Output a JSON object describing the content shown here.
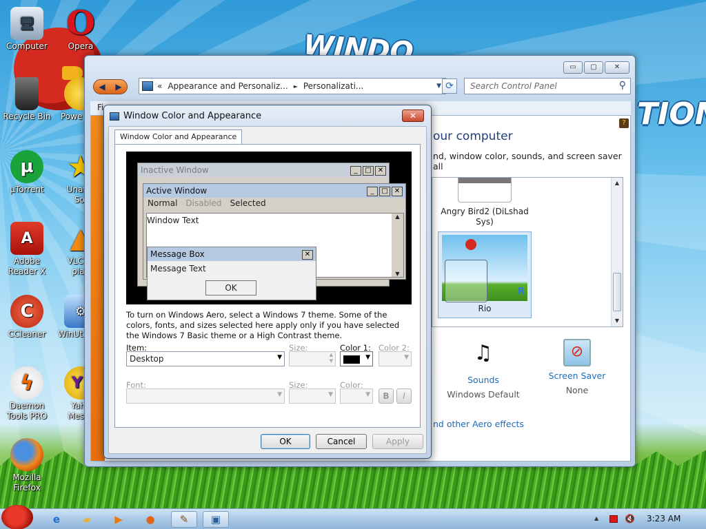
{
  "desktop": {
    "wallpaper_text_1": "WINDO",
    "wallpaper_text_2": "TION",
    "icons": [
      {
        "label": "Computer"
      },
      {
        "label": "Opera"
      },
      {
        "label": "Recycle Bin"
      },
      {
        "label": "Powe"
      },
      {
        "label": "µTorrent"
      },
      {
        "label": "Unatte\nSol"
      },
      {
        "label": "Adobe\nReader X"
      },
      {
        "label": "VLC m\nplay"
      },
      {
        "label": "CCleaner"
      },
      {
        "label": "WinUti"
      },
      {
        "label": "Daemon\nTools PRO"
      },
      {
        "label": "Yaho\nMesse"
      },
      {
        "label": "Mozilla\nFirefox"
      }
    ]
  },
  "control_panel": {
    "breadcrumb_sep": "«",
    "breadcrumb_1": "Appearance and Personaliz...",
    "breadcrumb_arrow": "►",
    "breadcrumb_2": "Personalizati...",
    "search_placeholder": "Search Control Panel",
    "menu_first": "Fi",
    "heading_fragment": "our computer",
    "subtext_fragment": "nd, window color, sounds, and screen saver all",
    "themes": [
      {
        "name": "Angry Bird2 (DiLshad Sys)"
      },
      {
        "name": "Rio"
      }
    ],
    "sounds_label": "Sounds",
    "sounds_value": "Windows Default",
    "screensaver_label": "Screen Saver",
    "screensaver_value": "None",
    "aero_link": "nd other Aero effects",
    "window_buttons": [
      "▭",
      "▢",
      "✕"
    ]
  },
  "dialog": {
    "title": "Window Color and Appearance",
    "close": "✕",
    "tab": "Window Color and Appearance",
    "preview": {
      "inactive_title": "Inactive Window",
      "active_title": "Active Window",
      "menu_normal": "Normal",
      "menu_disabled": "Disabled",
      "menu_selected": "Selected",
      "window_text": "Window Text",
      "msgbox_title": "Message Box",
      "msgbox_text": "Message Text",
      "msgbox_ok": "OK"
    },
    "description": "To turn on Windows Aero, select a Windows 7 theme.  Some of the colors, fonts, and sizes selected here apply only if you have selected the Windows 7 Basic theme or a High Contrast theme.",
    "item_label": "Item:",
    "item_value": "Desktop",
    "size_label": "Size:",
    "color1_label": "Color 1:",
    "color2_label": "Color 2:",
    "font_label": "Font:",
    "font_size_label": "Size:",
    "font_color_label": "Color:",
    "bold_label": "B",
    "italic_label": "I",
    "ok": "OK",
    "cancel": "Cancel",
    "apply": "Apply",
    "color1_value": "#000000"
  },
  "taskbar": {
    "clock": "3:23 AM",
    "tray_arrow": "▲"
  },
  "colors": {
    "accent_orange": "#e96f0b",
    "titlebar_active": "#c6d7ec",
    "link": "#1e6bb8"
  }
}
